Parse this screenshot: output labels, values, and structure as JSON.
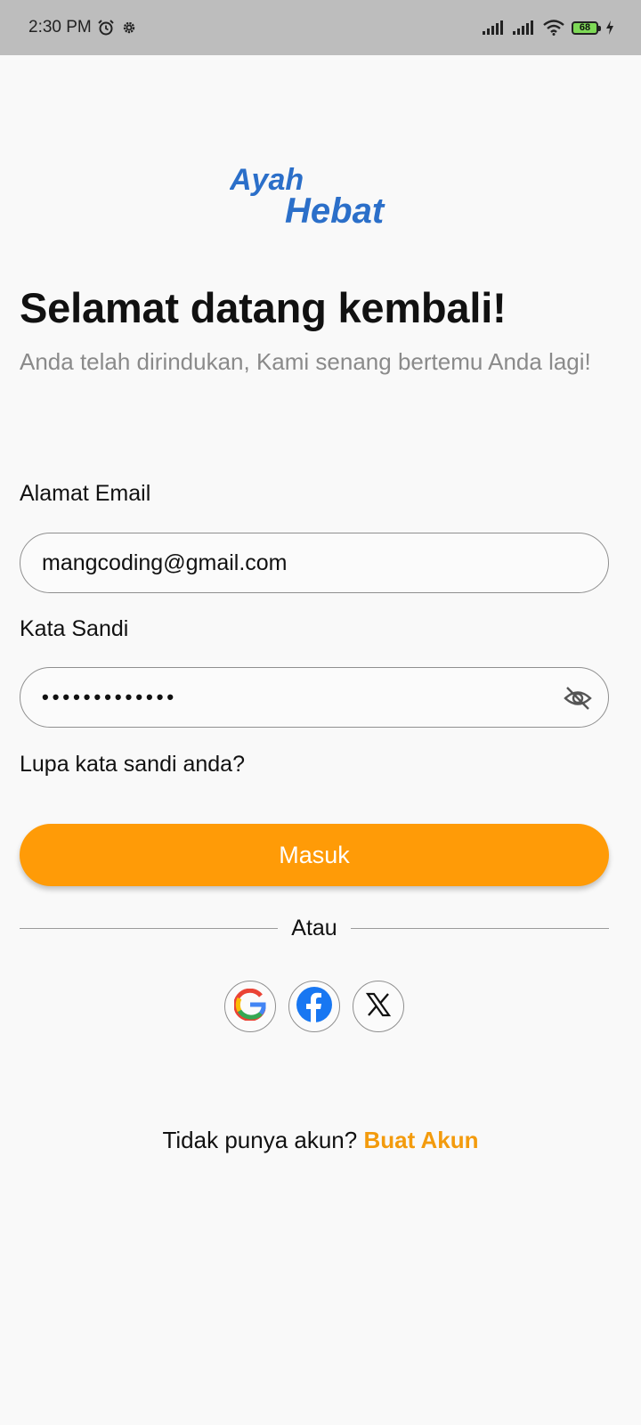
{
  "status_bar": {
    "time": "2:30 PM",
    "battery": "68"
  },
  "logo": {
    "line1": "Ayah",
    "line2": "Hebat"
  },
  "header": {
    "title": "Selamat datang kembali!",
    "subtitle": "Anda telah dirindukan, Kami senang bertemu Anda lagi!"
  },
  "form": {
    "email_label": "Alamat Email",
    "email_value": "mangcoding@gmail.com",
    "password_label": "Kata Sandi",
    "password_dots": "•••••••••••••",
    "forgot_label": "Lupa kata sandi anda?",
    "login_label": "Masuk"
  },
  "divider": {
    "label": "Atau"
  },
  "social": [
    "google-icon",
    "facebook-icon",
    "x-icon"
  ],
  "signup": {
    "prompt": "Tidak punya akun?",
    "link": "Buat Akun"
  },
  "colors": {
    "accent": "#ff9b07",
    "link": "#f39b0d",
    "logo_blue": "#2b6fc9"
  }
}
